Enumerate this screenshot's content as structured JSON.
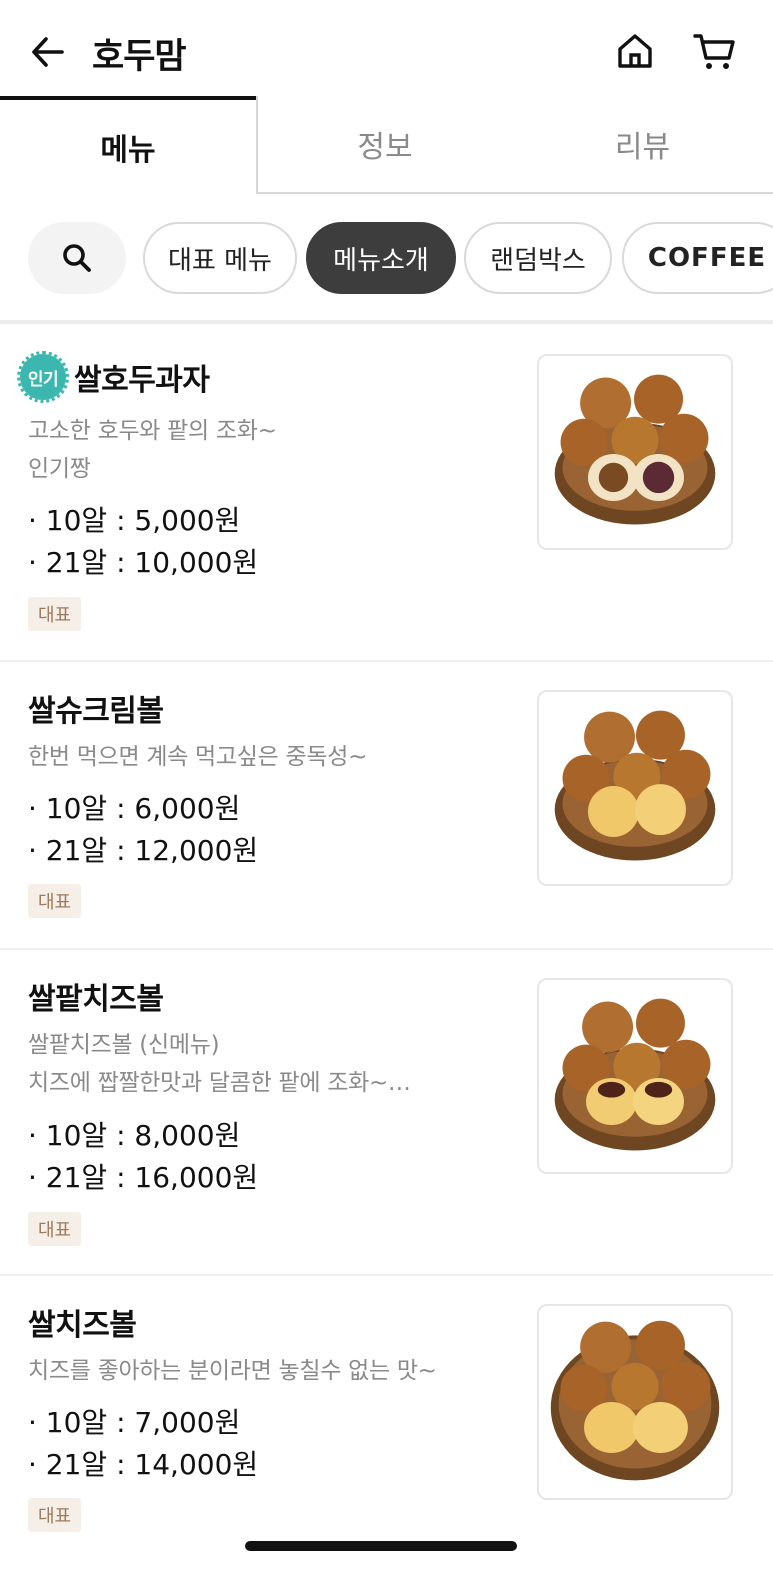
{
  "header": {
    "title": "호두맘",
    "back_icon": "arrow-left-icon",
    "home_icon": "home-icon",
    "cart_icon": "cart-icon"
  },
  "tabs": [
    {
      "label": "메뉴",
      "active": true
    },
    {
      "label": "정보",
      "active": false
    },
    {
      "label": "리뷰",
      "active": false
    }
  ],
  "chips": {
    "search_icon": "search-icon",
    "items": [
      {
        "label": "대표 메뉴",
        "selected": false
      },
      {
        "label": "메뉴소개",
        "selected": true
      },
      {
        "label": "랜덤박스",
        "selected": false
      },
      {
        "label": "COFFEE",
        "selected": false
      }
    ]
  },
  "menu_items": [
    {
      "badge": "인기",
      "name": "쌀호두과자",
      "desc_lines": [
        "고소한 호두와 팥의 조화~",
        "인기짱"
      ],
      "prices": [
        "· 10알 : 5,000원",
        "· 21알 : 10,000원"
      ],
      "tag": "대표"
    },
    {
      "name": "쌀슈크림볼",
      "desc_lines": [
        "한번 먹으면 계속 먹고싶은 중독성~"
      ],
      "prices": [
        "· 10알 : 6,000원",
        "· 21알 : 12,000원"
      ],
      "tag": "대표"
    },
    {
      "name": "쌀팥치즈볼",
      "desc_lines": [
        "쌀팥치즈볼 (신메뉴)",
        "치즈에 짭짤한맛과 달콤한 팥에 조화~…"
      ],
      "prices": [
        "· 10알 : 8,000원",
        "· 21알 : 16,000원"
      ],
      "tag": "대표"
    },
    {
      "name": "쌀치즈볼",
      "desc_lines": [
        "치즈를 좋아하는 분이라면 놓칠수 없는 맛~"
      ],
      "prices": [
        "· 10알 : 7,000원",
        "· 21알 : 14,000원"
      ],
      "tag": "대표"
    }
  ],
  "colors": {
    "accent_badge": "#3cb7b0",
    "chip_selected": "#3d3d3d",
    "tag_bg": "#f6efe8",
    "tag_text": "#9c7a5c"
  }
}
